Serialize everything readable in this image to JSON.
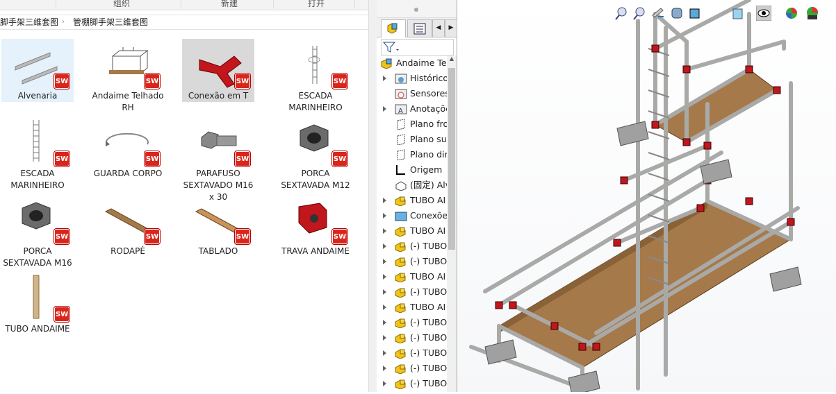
{
  "explorer": {
    "ribbon": {
      "organize": "组织",
      "new": "新建",
      "open": "打开"
    },
    "breadcrumb": {
      "parent": "脚手架三维套图",
      "separator": "›",
      "current": "管棚脚手架三维套图"
    },
    "files": [
      {
        "name": "Alvenaria",
        "badge": "SW"
      },
      {
        "name": "Andaime Telhado RH",
        "badge": "SW"
      },
      {
        "name": "Conexão em T",
        "badge": "SW"
      },
      {
        "name": "ESCADA MARINHEIRO",
        "badge": "SW"
      },
      {
        "name": "ESCADA MARINHEIRO",
        "badge": "SW"
      },
      {
        "name": "GUARDA CORPO",
        "badge": "SW"
      },
      {
        "name": "PARAFUSO SEXTAVADO M16 x 30",
        "badge": "SW"
      },
      {
        "name": "PORCA SEXTAVADA M12",
        "badge": "SW"
      },
      {
        "name": "PORCA SEXTAVADA M16",
        "badge": "SW"
      },
      {
        "name": "RODAPÉ",
        "badge": "SW"
      },
      {
        "name": "TABLADO",
        "badge": "SW"
      },
      {
        "name": "TRAVA ANDAIME",
        "badge": "SW"
      },
      {
        "name": "TUBO ANDAIME",
        "badge": "SW"
      }
    ]
  },
  "feature_manager": {
    "tree": [
      {
        "label": "Andaime Tel",
        "icon": "assembly-icon",
        "expandable": false,
        "root": true
      },
      {
        "label": "Histórico",
        "icon": "history-folder-icon",
        "expandable": true
      },
      {
        "label": "Sensores",
        "icon": "sensors-folder-icon",
        "expandable": false
      },
      {
        "label": "Anotações",
        "icon": "annotations-folder-icon",
        "expandable": true
      },
      {
        "label": "Plano fro",
        "icon": "plane-icon",
        "expandable": false
      },
      {
        "label": "Plano su",
        "icon": "plane-icon",
        "expandable": false
      },
      {
        "label": "Plano dir",
        "icon": "plane-icon",
        "expandable": false
      },
      {
        "label": "Origem",
        "icon": "origin-icon",
        "expandable": false
      },
      {
        "label": "(固定) Alv",
        "icon": "part-outline-icon",
        "expandable": false
      },
      {
        "label": "TUBO AI",
        "icon": "part-icon",
        "expandable": true
      },
      {
        "label": "Conexões",
        "icon": "folder-icon",
        "expandable": true
      },
      {
        "label": "TUBO AI",
        "icon": "part-icon",
        "expandable": true
      },
      {
        "label": "(-) TUBO",
        "icon": "part-icon",
        "expandable": true
      },
      {
        "label": "(-) TUBO",
        "icon": "part-icon",
        "expandable": true
      },
      {
        "label": "TUBO AI",
        "icon": "part-icon",
        "expandable": true
      },
      {
        "label": "(-) TUBO",
        "icon": "part-icon",
        "expandable": true
      },
      {
        "label": "TUBO AI",
        "icon": "part-icon",
        "expandable": true
      },
      {
        "label": "(-) TUBO",
        "icon": "part-icon",
        "expandable": true
      },
      {
        "label": "(-) TUBO",
        "icon": "part-icon",
        "expandable": true
      },
      {
        "label": "(-) TUBO",
        "icon": "part-icon",
        "expandable": true
      },
      {
        "label": "(-) TUBO",
        "icon": "part-icon",
        "expandable": true
      },
      {
        "label": "(-) TUBO",
        "icon": "part-icon",
        "expandable": true
      }
    ]
  },
  "viewport": {
    "toolbar": [
      "zoom-to-fit-icon",
      "zoom-to-area-icon",
      "previous-view-icon",
      "section-view-icon",
      "view-orientation-icon",
      "display-style-icon",
      "hide-show-icon",
      "edit-appearance-icon",
      "apply-scene-icon"
    ],
    "colors": {
      "tube": "#a9aaa7",
      "wood": "#a6794a",
      "clamp": "#c0161c"
    }
  }
}
